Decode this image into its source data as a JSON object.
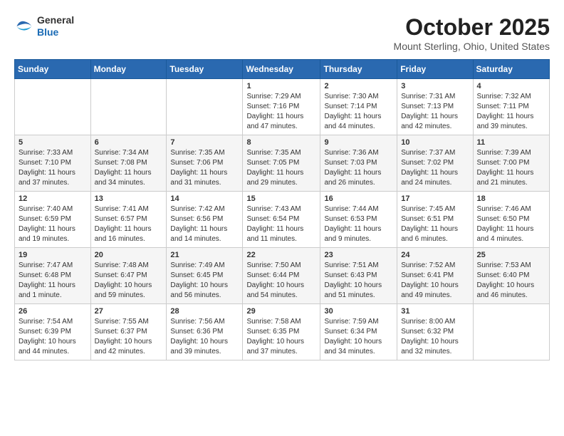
{
  "header": {
    "logo": {
      "general": "General",
      "blue": "Blue"
    },
    "title": "October 2025",
    "location": "Mount Sterling, Ohio, United States"
  },
  "weekdays": [
    "Sunday",
    "Monday",
    "Tuesday",
    "Wednesday",
    "Thursday",
    "Friday",
    "Saturday"
  ],
  "weeks": [
    [
      {
        "day": "",
        "info": ""
      },
      {
        "day": "",
        "info": ""
      },
      {
        "day": "",
        "info": ""
      },
      {
        "day": "1",
        "info": "Sunrise: 7:29 AM\nSunset: 7:16 PM\nDaylight: 11 hours and 47 minutes."
      },
      {
        "day": "2",
        "info": "Sunrise: 7:30 AM\nSunset: 7:14 PM\nDaylight: 11 hours and 44 minutes."
      },
      {
        "day": "3",
        "info": "Sunrise: 7:31 AM\nSunset: 7:13 PM\nDaylight: 11 hours and 42 minutes."
      },
      {
        "day": "4",
        "info": "Sunrise: 7:32 AM\nSunset: 7:11 PM\nDaylight: 11 hours and 39 minutes."
      }
    ],
    [
      {
        "day": "5",
        "info": "Sunrise: 7:33 AM\nSunset: 7:10 PM\nDaylight: 11 hours and 37 minutes."
      },
      {
        "day": "6",
        "info": "Sunrise: 7:34 AM\nSunset: 7:08 PM\nDaylight: 11 hours and 34 minutes."
      },
      {
        "day": "7",
        "info": "Sunrise: 7:35 AM\nSunset: 7:06 PM\nDaylight: 11 hours and 31 minutes."
      },
      {
        "day": "8",
        "info": "Sunrise: 7:35 AM\nSunset: 7:05 PM\nDaylight: 11 hours and 29 minutes."
      },
      {
        "day": "9",
        "info": "Sunrise: 7:36 AM\nSunset: 7:03 PM\nDaylight: 11 hours and 26 minutes."
      },
      {
        "day": "10",
        "info": "Sunrise: 7:37 AM\nSunset: 7:02 PM\nDaylight: 11 hours and 24 minutes."
      },
      {
        "day": "11",
        "info": "Sunrise: 7:39 AM\nSunset: 7:00 PM\nDaylight: 11 hours and 21 minutes."
      }
    ],
    [
      {
        "day": "12",
        "info": "Sunrise: 7:40 AM\nSunset: 6:59 PM\nDaylight: 11 hours and 19 minutes."
      },
      {
        "day": "13",
        "info": "Sunrise: 7:41 AM\nSunset: 6:57 PM\nDaylight: 11 hours and 16 minutes."
      },
      {
        "day": "14",
        "info": "Sunrise: 7:42 AM\nSunset: 6:56 PM\nDaylight: 11 hours and 14 minutes."
      },
      {
        "day": "15",
        "info": "Sunrise: 7:43 AM\nSunset: 6:54 PM\nDaylight: 11 hours and 11 minutes."
      },
      {
        "day": "16",
        "info": "Sunrise: 7:44 AM\nSunset: 6:53 PM\nDaylight: 11 hours and 9 minutes."
      },
      {
        "day": "17",
        "info": "Sunrise: 7:45 AM\nSunset: 6:51 PM\nDaylight: 11 hours and 6 minutes."
      },
      {
        "day": "18",
        "info": "Sunrise: 7:46 AM\nSunset: 6:50 PM\nDaylight: 11 hours and 4 minutes."
      }
    ],
    [
      {
        "day": "19",
        "info": "Sunrise: 7:47 AM\nSunset: 6:48 PM\nDaylight: 11 hours and 1 minute."
      },
      {
        "day": "20",
        "info": "Sunrise: 7:48 AM\nSunset: 6:47 PM\nDaylight: 10 hours and 59 minutes."
      },
      {
        "day": "21",
        "info": "Sunrise: 7:49 AM\nSunset: 6:45 PM\nDaylight: 10 hours and 56 minutes."
      },
      {
        "day": "22",
        "info": "Sunrise: 7:50 AM\nSunset: 6:44 PM\nDaylight: 10 hours and 54 minutes."
      },
      {
        "day": "23",
        "info": "Sunrise: 7:51 AM\nSunset: 6:43 PM\nDaylight: 10 hours and 51 minutes."
      },
      {
        "day": "24",
        "info": "Sunrise: 7:52 AM\nSunset: 6:41 PM\nDaylight: 10 hours and 49 minutes."
      },
      {
        "day": "25",
        "info": "Sunrise: 7:53 AM\nSunset: 6:40 PM\nDaylight: 10 hours and 46 minutes."
      }
    ],
    [
      {
        "day": "26",
        "info": "Sunrise: 7:54 AM\nSunset: 6:39 PM\nDaylight: 10 hours and 44 minutes."
      },
      {
        "day": "27",
        "info": "Sunrise: 7:55 AM\nSunset: 6:37 PM\nDaylight: 10 hours and 42 minutes."
      },
      {
        "day": "28",
        "info": "Sunrise: 7:56 AM\nSunset: 6:36 PM\nDaylight: 10 hours and 39 minutes."
      },
      {
        "day": "29",
        "info": "Sunrise: 7:58 AM\nSunset: 6:35 PM\nDaylight: 10 hours and 37 minutes."
      },
      {
        "day": "30",
        "info": "Sunrise: 7:59 AM\nSunset: 6:34 PM\nDaylight: 10 hours and 34 minutes."
      },
      {
        "day": "31",
        "info": "Sunrise: 8:00 AM\nSunset: 6:32 PM\nDaylight: 10 hours and 32 minutes."
      },
      {
        "day": "",
        "info": ""
      }
    ]
  ]
}
